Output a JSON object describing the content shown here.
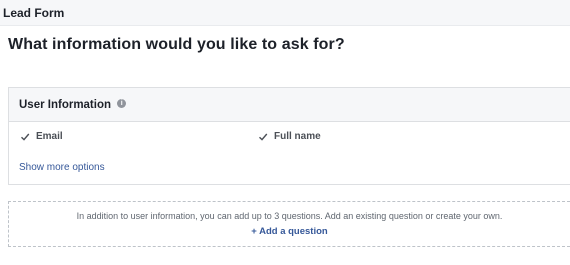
{
  "topbar": {
    "title": "Lead Form"
  },
  "heading": "What information would you like to ask for?",
  "user_info": {
    "title": "User Information",
    "info_icon": "i",
    "options": [
      {
        "label": "Email",
        "checked": true
      },
      {
        "label": "Full name",
        "checked": true
      }
    ],
    "show_more": "Show more options"
  },
  "questions": {
    "note": "In addition to user information, you can add up to 3 questions. Add an existing question or create your own.",
    "add_label": "+ Add a question"
  },
  "colors": {
    "link": "#365899",
    "text": "#1d2129",
    "muted": "#606770",
    "header_bg": "#f6f7f9",
    "border": "#dddfe2"
  }
}
